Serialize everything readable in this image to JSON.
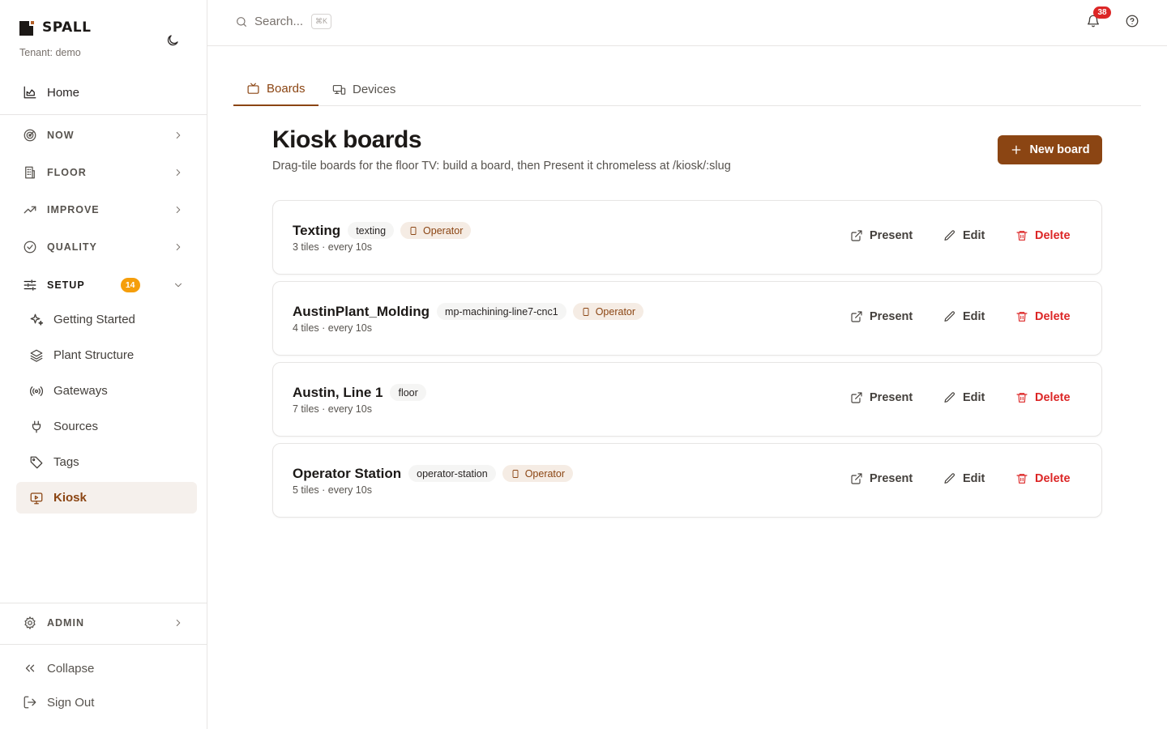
{
  "brand": {
    "logo_text": "SPALL",
    "tenant": "Tenant: demo"
  },
  "sidebar": {
    "home": "Home",
    "sections": [
      {
        "label": "NOW"
      },
      {
        "label": "FLOOR"
      },
      {
        "label": "IMPROVE"
      },
      {
        "label": "QUALITY"
      },
      {
        "label": "SETUP",
        "badge": "14"
      }
    ],
    "setup_items": [
      {
        "label": "Getting Started"
      },
      {
        "label": "Plant Structure"
      },
      {
        "label": "Gateways"
      },
      {
        "label": "Sources"
      },
      {
        "label": "Tags"
      },
      {
        "label": "Kiosk"
      }
    ],
    "admin": "ADMIN",
    "collapse": "Collapse",
    "sign_out": "Sign Out"
  },
  "topbar": {
    "search_placeholder": "Search...",
    "shortcut": "⌘K",
    "notification_count": "38"
  },
  "tabs": [
    {
      "label": "Boards",
      "active": true
    },
    {
      "label": "Devices",
      "active": false
    }
  ],
  "page": {
    "title": "Kiosk boards",
    "subtitle": "Drag-tile boards for the floor TV: build a board, then Present it chromeless at /kiosk/:slug",
    "new_button": "New board"
  },
  "boards": [
    {
      "name": "Texting",
      "slug": "texting",
      "role": "Operator",
      "meta": "3 tiles · every 10s"
    },
    {
      "name": "AustinPlant_Molding",
      "slug": "mp-machining-line7-cnc1",
      "role": "Operator",
      "meta": "4 tiles · every 10s"
    },
    {
      "name": "Austin, Line 1",
      "slug": "floor",
      "role": "",
      "meta": "7 tiles · every 10s"
    },
    {
      "name": "Operator Station",
      "slug": "operator-station",
      "role": "Operator",
      "meta": "5 tiles · every 10s"
    }
  ],
  "actions": {
    "present": "Present",
    "edit": "Edit",
    "delete": "Delete"
  },
  "colors": {
    "accent": "#8b4513",
    "danger": "#dc2626",
    "setup_badge": "#f59e0b"
  }
}
